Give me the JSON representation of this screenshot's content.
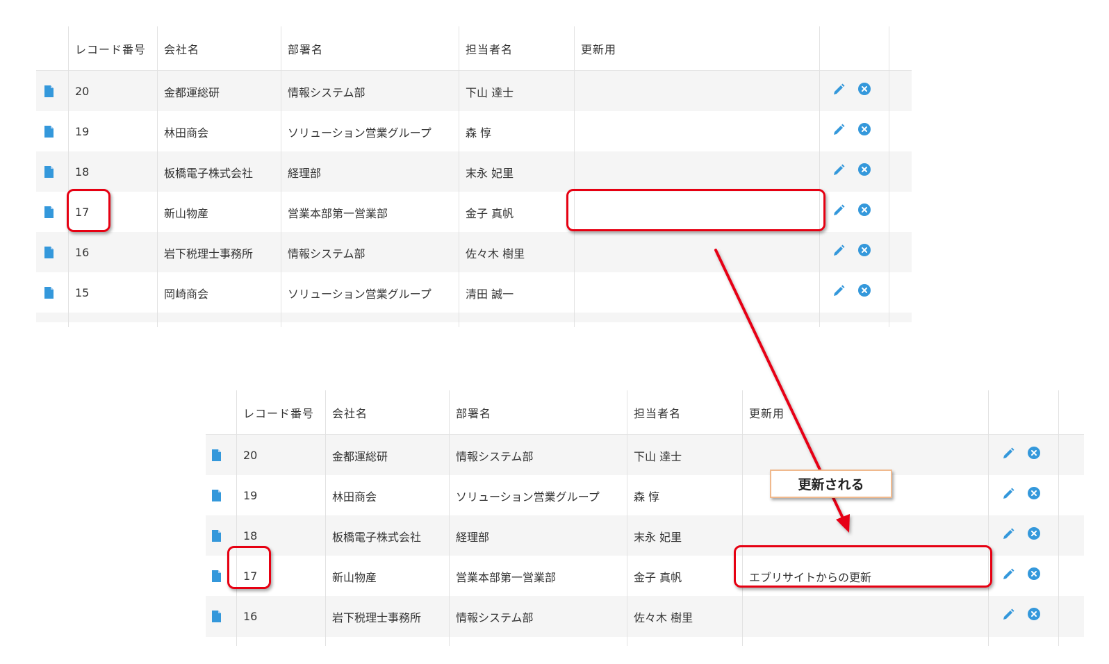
{
  "columns": [
    "レコード番号",
    "会社名",
    "部署名",
    "担当者名",
    "更新用"
  ],
  "before_rows": [
    {
      "id": "20",
      "company": "金都運総研",
      "dept": "情報システム部",
      "person": "下山 達士",
      "update": ""
    },
    {
      "id": "19",
      "company": "林田商会",
      "dept": "ソリューション営業グループ",
      "person": "森 惇",
      "update": ""
    },
    {
      "id": "18",
      "company": "板橋電子株式会社",
      "dept": "経理部",
      "person": "末永 妃里",
      "update": ""
    },
    {
      "id": "17",
      "company": "新山物産",
      "dept": "営業本部第一営業部",
      "person": "金子 真帆",
      "update": ""
    },
    {
      "id": "16",
      "company": "岩下税理士事務所",
      "dept": "情報システム部",
      "person": "佐々木 樹里",
      "update": ""
    },
    {
      "id": "15",
      "company": "岡崎商会",
      "dept": "ソリューション営業グループ",
      "person": "清田 誠一",
      "update": ""
    }
  ],
  "after_rows": [
    {
      "id": "20",
      "company": "金都運総研",
      "dept": "情報システム部",
      "person": "下山 達士",
      "update": ""
    },
    {
      "id": "19",
      "company": "林田商会",
      "dept": "ソリューション営業グループ",
      "person": "森 惇",
      "update": ""
    },
    {
      "id": "18",
      "company": "板橋電子株式会社",
      "dept": "経理部",
      "person": "末永 妃里",
      "update": ""
    },
    {
      "id": "17",
      "company": "新山物産",
      "dept": "営業本部第一営業部",
      "person": "金子 真帆",
      "update": "エブリサイトからの更新"
    },
    {
      "id": "16",
      "company": "岩下税理士事務所",
      "dept": "情報システム部",
      "person": "佐々木 樹里",
      "update": ""
    }
  ],
  "callout_text": "更新される",
  "colors": {
    "accent_blue": "#3498db",
    "highlight_red": "#e60012",
    "callout_border": "#f0b98d",
    "row_stripe": "#f5f5f5"
  },
  "icons": {
    "row_icon": "document-icon",
    "edit_icon": "pencil-icon",
    "delete_icon": "close-circle-icon"
  }
}
